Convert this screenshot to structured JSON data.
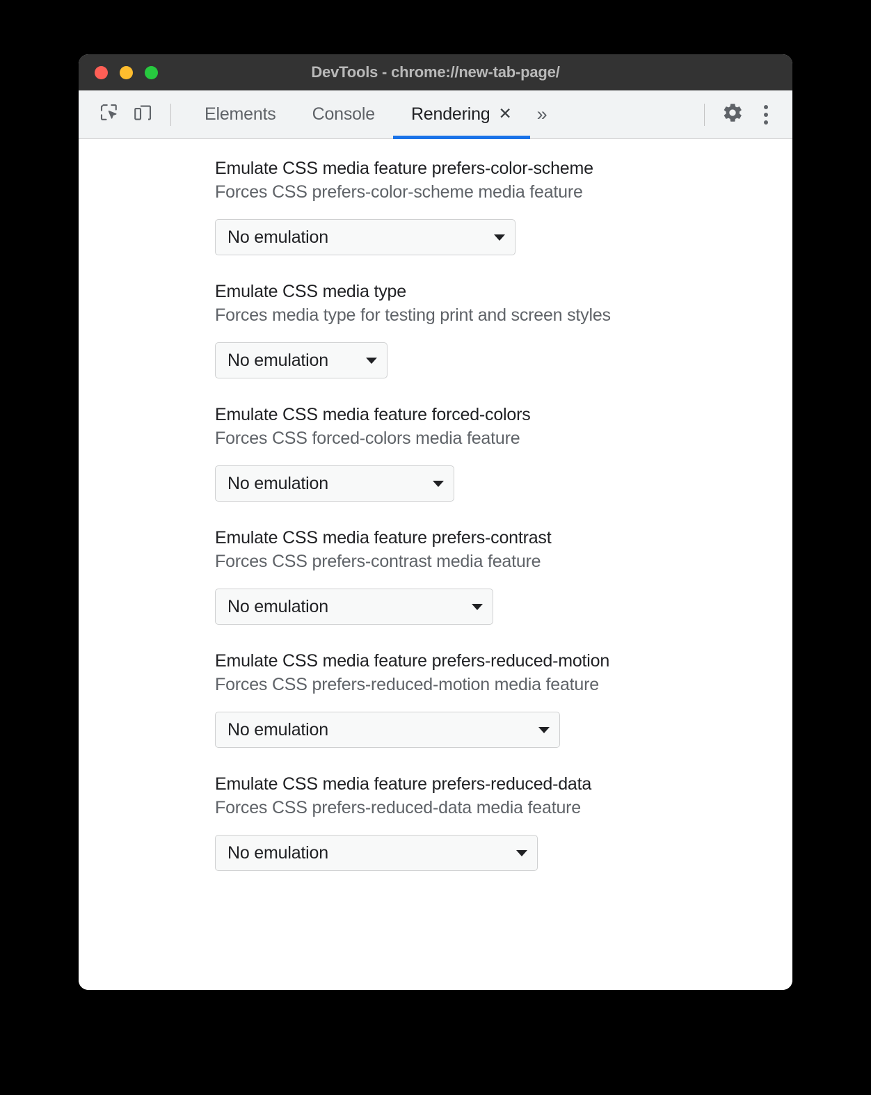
{
  "window": {
    "title": "DevTools - chrome://new-tab-page/",
    "traffic_lights": [
      {
        "name": "close",
        "color": "#ff5f56"
      },
      {
        "name": "minimize",
        "color": "#ffbd2e"
      },
      {
        "name": "maximize",
        "color": "#27c93f"
      }
    ],
    "titlebar_color": "#333333"
  },
  "toolbar": {
    "inspect_icon": "inspect-element-icon",
    "device_toggle_icon": "device-toolbar-icon",
    "tabs": [
      {
        "label": "Elements",
        "active": false,
        "closable": false
      },
      {
        "label": "Console",
        "active": false,
        "closable": false
      },
      {
        "label": "Rendering",
        "active": true,
        "closable": true,
        "close_glyph": "✕"
      }
    ],
    "more_tabs_glyph": "»",
    "settings_icon": "gear-icon",
    "menu_icon": "more-vertical-icon",
    "active_tab_underline_color": "#1a73e8",
    "background_color": "#f1f3f4"
  },
  "panel": {
    "settings": [
      {
        "title": "Emulate CSS media feature prefers-color-scheme",
        "description": "Forces CSS prefers-color-scheme media feature",
        "select_value": "No emulation",
        "width_class": "w-432"
      },
      {
        "title": "Emulate CSS media type",
        "description": "Forces media type for testing print and screen styles",
        "select_value": "No emulation",
        "width_class": "w-248"
      },
      {
        "title": "Emulate CSS media feature forced-colors",
        "description": "Forces CSS forced-colors media feature",
        "select_value": "No emulation",
        "width_class": "w-344"
      },
      {
        "title": "Emulate CSS media feature prefers-contrast",
        "description": "Forces CSS prefers-contrast media feature",
        "select_value": "No emulation",
        "width_class": "w-400"
      },
      {
        "title": "Emulate CSS media feature prefers-reduced-motion",
        "description": "Forces CSS prefers-reduced-motion media feature",
        "select_value": "No emulation",
        "width_class": "w-496"
      },
      {
        "title": "Emulate CSS media feature prefers-reduced-data",
        "description": "Forces CSS prefers-reduced-data media feature",
        "select_value": "No emulation",
        "width_class": "w-464"
      }
    ]
  }
}
